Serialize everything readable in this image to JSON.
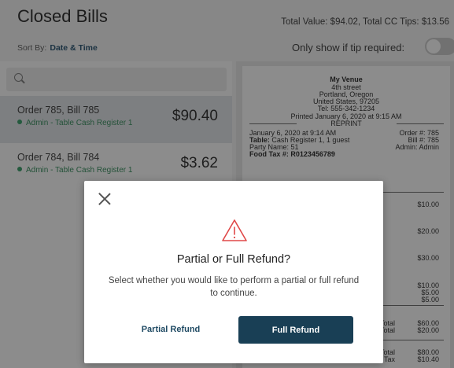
{
  "header": {
    "title": "Closed Bills",
    "totals": "Total Value: $94.02, Total CC Tips: $13.56"
  },
  "sort": {
    "label": "Sort By:",
    "value": "Date & Time"
  },
  "tip_filter": {
    "label": "Only show if tip required:",
    "enabled": false
  },
  "orders": [
    {
      "title": "Order 785, Bill 785",
      "subtitle": "Admin - Table Cash Register 1",
      "amount": "$90.40",
      "selected": true
    },
    {
      "title": "Order 784, Bill 784",
      "subtitle": "Admin - Table Cash Register 1",
      "amount": "$3.62",
      "selected": false
    }
  ],
  "receipt": {
    "venue": "My Venue",
    "address": [
      "4th street",
      "Portland, Oregon",
      "United States, 97205"
    ],
    "tel": "Tel: 555-342-1234",
    "printed": "Printed January 6, 2020 at 9:15 AM",
    "reprint": "REPRINT",
    "date": "January 6, 2020 at 9:14 AM",
    "order_no": "Order #: 785",
    "table_label": "Table:",
    "table_value": "Cash Register 1, 1 guest",
    "bill_no": "Bill #: 785",
    "party_name": "Party Name: 51",
    "admin": "Admin: Admin",
    "food_tax_label": "Food Tax #:",
    "food_tax_value": "R0123456789",
    "line_prices": [
      "$10.00",
      "$20.00",
      "$30.00"
    ],
    "extra_prices": [
      "$10.00",
      "$5.00",
      "$5.00"
    ],
    "subtotal_label": "Total",
    "subtotal_value": "$60.00",
    "total_label": "Total",
    "total_value": "$20.00",
    "grand_label": "Total",
    "grand_value": "$80.00",
    "tax_label": "Tax",
    "tax_value": "$10.40"
  },
  "dialog": {
    "title": "Partial or Full Refund?",
    "message": "Select whether you would like to perform a partial or full refund to continue.",
    "partial_label": "Partial Refund",
    "full_label": "Full Refund",
    "accent_color": "#193f55",
    "warning_color": "#e04848"
  },
  "icons": [
    "search-icon",
    "close-icon",
    "warning-icon",
    "status-dot-icon"
  ]
}
